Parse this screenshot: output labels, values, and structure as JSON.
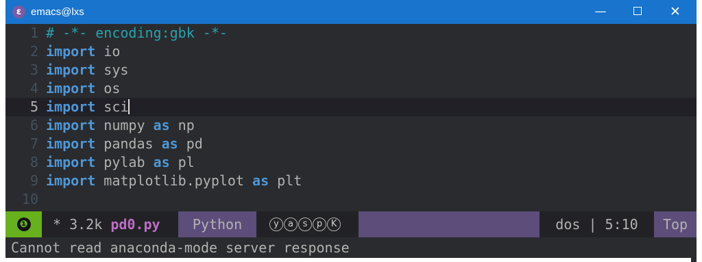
{
  "window": {
    "title": "emacs@lxs",
    "icon": "emacs-icon",
    "controls": {
      "minimize": "—",
      "close": "✕"
    }
  },
  "editor": {
    "lines": [
      {
        "num": "1",
        "tokens": [
          {
            "t": "# -*- encoding:gbk -*-",
            "c": "cm"
          }
        ]
      },
      {
        "num": "2",
        "tokens": [
          {
            "t": "import",
            "c": "kw"
          },
          {
            "t": " io"
          }
        ]
      },
      {
        "num": "3",
        "tokens": [
          {
            "t": "import",
            "c": "kw"
          },
          {
            "t": " sys"
          }
        ]
      },
      {
        "num": "4",
        "tokens": [
          {
            "t": "import",
            "c": "kw"
          },
          {
            "t": " os"
          }
        ]
      },
      {
        "num": "5",
        "current": true,
        "tokens": [
          {
            "t": "import",
            "c": "kw"
          },
          {
            "t": " sci"
          }
        ]
      },
      {
        "num": "6",
        "tokens": [
          {
            "t": "import",
            "c": "kw"
          },
          {
            "t": " numpy "
          },
          {
            "t": "as",
            "c": "kw"
          },
          {
            "t": " np"
          }
        ]
      },
      {
        "num": "7",
        "tokens": [
          {
            "t": "import",
            "c": "kw"
          },
          {
            "t": " pandas "
          },
          {
            "t": "as",
            "c": "kw"
          },
          {
            "t": " pd"
          }
        ]
      },
      {
        "num": "8",
        "tokens": [
          {
            "t": "import",
            "c": "kw"
          },
          {
            "t": " pylab "
          },
          {
            "t": "as",
            "c": "kw"
          },
          {
            "t": " pl"
          }
        ]
      },
      {
        "num": "9",
        "tokens": [
          {
            "t": "import",
            "c": "kw"
          },
          {
            "t": " matplotlib.pyplot "
          },
          {
            "t": "as",
            "c": "kw"
          },
          {
            "t": " plt"
          }
        ]
      },
      {
        "num": "10",
        "tokens": []
      }
    ]
  },
  "modeline": {
    "window_number": "❶",
    "modified": "*",
    "size": "3.2k",
    "filename": "pd0.py",
    "major_mode": "Python",
    "minor_modes": [
      "y",
      "a",
      "s",
      "p",
      "K"
    ],
    "eol": "dos",
    "separator": "|",
    "position": "5:10",
    "scroll": "Top"
  },
  "echo_area": {
    "message": "Cannot read anaconda-mode server response"
  },
  "colors": {
    "background": "#292b2e",
    "keyword": "#4f97d7",
    "comment": "#2aa1ae",
    "text": "#b2b2b2",
    "filename": "#bc6ec5",
    "modeline_accent": "#5d4d7a",
    "window_number_bg": "#67b11d",
    "titlebar": "#1874cd"
  }
}
